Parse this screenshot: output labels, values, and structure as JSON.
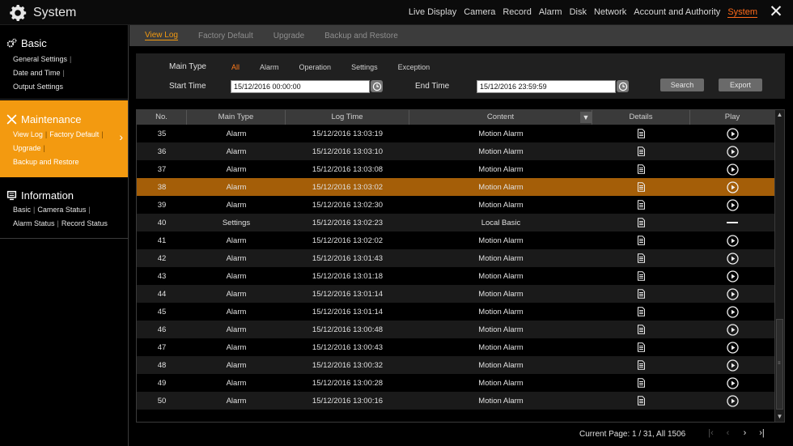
{
  "app": {
    "title": "System"
  },
  "topnav": [
    "Live Display",
    "Camera",
    "Record",
    "Alarm",
    "Disk",
    "Network",
    "Account and Authority",
    "System"
  ],
  "topnav_active": "System",
  "sidebar": {
    "basic": {
      "title": "Basic",
      "links": [
        "General Settings",
        "Date and Time",
        "Output Settings"
      ]
    },
    "maintenance": {
      "title": "Maintenance",
      "links": [
        "View Log",
        "Factory Default",
        "Upgrade",
        "Backup and Restore"
      ]
    },
    "information": {
      "title": "Information",
      "links": [
        "Basic",
        "Camera Status",
        "Alarm Status",
        "Record Status"
      ]
    }
  },
  "subtabs": [
    "View Log",
    "Factory Default",
    "Upgrade",
    "Backup and Restore"
  ],
  "filters": {
    "main_type_label": "Main Type",
    "types": [
      "All",
      "Alarm",
      "Operation",
      "Settings",
      "Exception"
    ],
    "start_label": "Start Time",
    "start_value": "15/12/2016 00:00:00",
    "end_label": "End Time",
    "end_value": "15/12/2016 23:59:59",
    "search_label": "Search",
    "export_label": "Export"
  },
  "table": {
    "headers": [
      "No.",
      "Main Type",
      "Log Time",
      "Content",
      "Details",
      "Play"
    ],
    "rows": [
      {
        "no": "35",
        "type": "Alarm",
        "time": "15/12/2016 13:03:19",
        "content": "Motion Alarm",
        "play": true
      },
      {
        "no": "36",
        "type": "Alarm",
        "time": "15/12/2016 13:03:10",
        "content": "Motion Alarm",
        "play": true
      },
      {
        "no": "37",
        "type": "Alarm",
        "time": "15/12/2016 13:03:08",
        "content": "Motion Alarm",
        "play": true
      },
      {
        "no": "38",
        "type": "Alarm",
        "time": "15/12/2016 13:03:02",
        "content": "Motion Alarm",
        "play": true
      },
      {
        "no": "39",
        "type": "Alarm",
        "time": "15/12/2016 13:02:30",
        "content": "Motion Alarm",
        "play": true
      },
      {
        "no": "40",
        "type": "Settings",
        "time": "15/12/2016 13:02:23",
        "content": "Local Basic",
        "play": false
      },
      {
        "no": "41",
        "type": "Alarm",
        "time": "15/12/2016 13:02:02",
        "content": "Motion Alarm",
        "play": true
      },
      {
        "no": "42",
        "type": "Alarm",
        "time": "15/12/2016 13:01:43",
        "content": "Motion Alarm",
        "play": true
      },
      {
        "no": "43",
        "type": "Alarm",
        "time": "15/12/2016 13:01:18",
        "content": "Motion Alarm",
        "play": true
      },
      {
        "no": "44",
        "type": "Alarm",
        "time": "15/12/2016 13:01:14",
        "content": "Motion Alarm",
        "play": true
      },
      {
        "no": "45",
        "type": "Alarm",
        "time": "15/12/2016 13:01:14",
        "content": "Motion Alarm",
        "play": true
      },
      {
        "no": "46",
        "type": "Alarm",
        "time": "15/12/2016 13:00:48",
        "content": "Motion Alarm",
        "play": true
      },
      {
        "no": "47",
        "type": "Alarm",
        "time": "15/12/2016 13:00:43",
        "content": "Motion Alarm",
        "play": true
      },
      {
        "no": "48",
        "type": "Alarm",
        "time": "15/12/2016 13:00:32",
        "content": "Motion Alarm",
        "play": true
      },
      {
        "no": "49",
        "type": "Alarm",
        "time": "15/12/2016 13:00:28",
        "content": "Motion Alarm",
        "play": true
      },
      {
        "no": "50",
        "type": "Alarm",
        "time": "15/12/2016 13:00:16",
        "content": "Motion Alarm",
        "play": true
      }
    ],
    "selected_no": "38"
  },
  "pager": {
    "text": "Current Page: 1 / 31, All 1506"
  },
  "colors": {
    "accent": "#f39a10",
    "active_text": "#ff6a1a",
    "selected_row": "#a45e08"
  },
  "icons": {
    "logo": "gear-icon",
    "close": "close-icon",
    "basic": "gears-icon",
    "maintenance": "tools-icon",
    "information": "monitor-icon",
    "details": "document-icon",
    "play": "play-circle-icon",
    "clock": "clock-icon"
  }
}
